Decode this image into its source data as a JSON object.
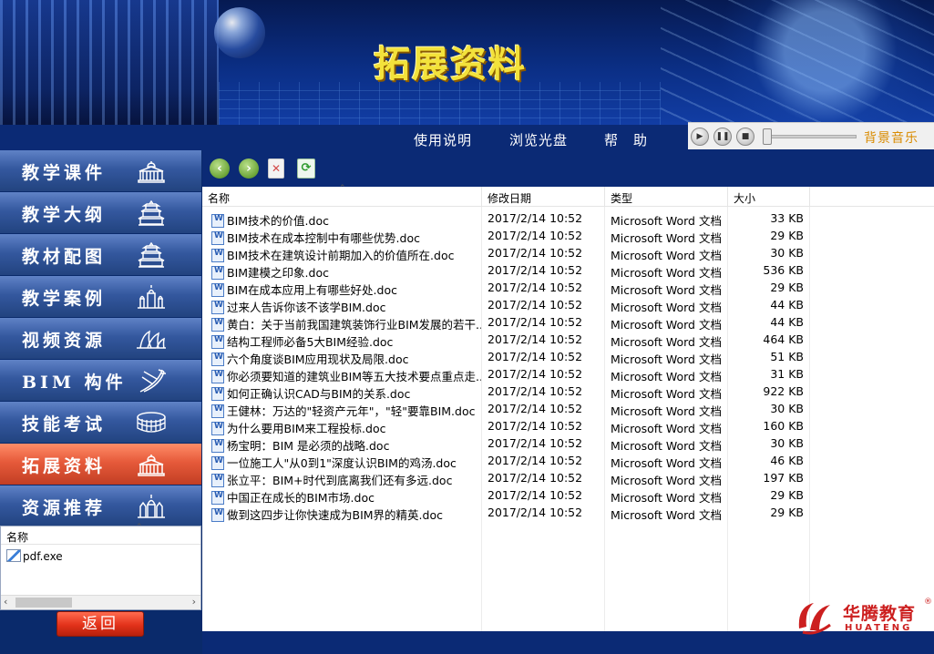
{
  "banner": {
    "title": "拓展资料"
  },
  "topnav": {
    "items": [
      "使用说明",
      "浏览光盘",
      "帮　助"
    ]
  },
  "music": {
    "label": "背景音乐"
  },
  "sidebar": {
    "items": [
      {
        "label": "教学课件",
        "icon": "capitol-icon"
      },
      {
        "label": "教学大纲",
        "icon": "temple-icon"
      },
      {
        "label": "教材配图",
        "icon": "temple-icon"
      },
      {
        "label": "教学案例",
        "icon": "cathedral-icon"
      },
      {
        "label": "视频资源",
        "icon": "opera-house-icon"
      },
      {
        "label": "BIM 构件",
        "icon": "bridge-icon"
      },
      {
        "label": "技能考试",
        "icon": "colosseum-icon"
      },
      {
        "label": "拓展资料",
        "icon": "capitol-icon",
        "active": true
      },
      {
        "label": "资源推荐",
        "icon": "palace-icon"
      }
    ],
    "active_color": "#e65a3a",
    "base_color": "#34589f"
  },
  "leftpanel": {
    "header": "名称",
    "file": "pdf.exe"
  },
  "back_label": "返回",
  "columns": {
    "name": "名称",
    "date": "修改日期",
    "type": "类型",
    "size": "大小"
  },
  "files": [
    {
      "name": "BIM技术的价值.doc",
      "date": "2017/2/14 10:52",
      "type": "Microsoft Word 文档",
      "size": "33 KB"
    },
    {
      "name": "BIM技术在成本控制中有哪些优势.doc",
      "date": "2017/2/14 10:52",
      "type": "Microsoft Word 文档",
      "size": "29 KB"
    },
    {
      "name": "BIM技术在建筑设计前期加入的价值所在.doc",
      "date": "2017/2/14 10:52",
      "type": "Microsoft Word 文档",
      "size": "30 KB"
    },
    {
      "name": "BIM建模之印象.doc",
      "date": "2017/2/14 10:52",
      "type": "Microsoft Word 文档",
      "size": "536 KB"
    },
    {
      "name": "BIM在成本应用上有哪些好处.doc",
      "date": "2017/2/14 10:52",
      "type": "Microsoft Word 文档",
      "size": "29 KB"
    },
    {
      "name": "过来人告诉你该不该学BIM.doc",
      "date": "2017/2/14 10:52",
      "type": "Microsoft Word 文档",
      "size": "44 KB"
    },
    {
      "name": "黄白：关于当前我国建筑装饰行业BIM发展的若干...",
      "date": "2017/2/14 10:52",
      "type": "Microsoft Word 文档",
      "size": "44 KB"
    },
    {
      "name": "结构工程师必备5大BIM经验.doc",
      "date": "2017/2/14 10:52",
      "type": "Microsoft Word 文档",
      "size": "464 KB"
    },
    {
      "name": "六个角度谈BIM应用现状及局限.doc",
      "date": "2017/2/14 10:52",
      "type": "Microsoft Word 文档",
      "size": "51 KB"
    },
    {
      "name": "你必须要知道的建筑业BIM等五大技术要点重点走...",
      "date": "2017/2/14 10:52",
      "type": "Microsoft Word 文档",
      "size": "31 KB"
    },
    {
      "name": "如何正确认识CAD与BIM的关系.doc",
      "date": "2017/2/14 10:52",
      "type": "Microsoft Word 文档",
      "size": "922 KB"
    },
    {
      "name": "王健林：万达的\"轻资产元年\"，\"轻\"要靠BIM.doc",
      "date": "2017/2/14 10:52",
      "type": "Microsoft Word 文档",
      "size": "30 KB"
    },
    {
      "name": "为什么要用BIM来工程投标.doc",
      "date": "2017/2/14 10:52",
      "type": "Microsoft Word 文档",
      "size": "160 KB"
    },
    {
      "name": "杨宝明：BIM 是必须的战略.doc",
      "date": "2017/2/14 10:52",
      "type": "Microsoft Word 文档",
      "size": "30 KB"
    },
    {
      "name": "一位施工人\"从0到1\"深度认识BIM的鸡汤.doc",
      "date": "2017/2/14 10:52",
      "type": "Microsoft Word 文档",
      "size": "46 KB"
    },
    {
      "name": "张立平：BIM+时代到底离我们还有多远.doc",
      "date": "2017/2/14 10:52",
      "type": "Microsoft Word 文档",
      "size": "197 KB"
    },
    {
      "name": "中国正在成长的BIM市场.doc",
      "date": "2017/2/14 10:52",
      "type": "Microsoft Word 文档",
      "size": "29 KB"
    },
    {
      "name": "做到这四步让你快速成为BIM界的精英.doc",
      "date": "2017/2/14 10:52",
      "type": "Microsoft Word 文档",
      "size": "29 KB"
    }
  ],
  "logo": {
    "cn": "华腾教育",
    "en": "HUATENG",
    "reg": "®",
    "color": "#cc1f1f"
  }
}
